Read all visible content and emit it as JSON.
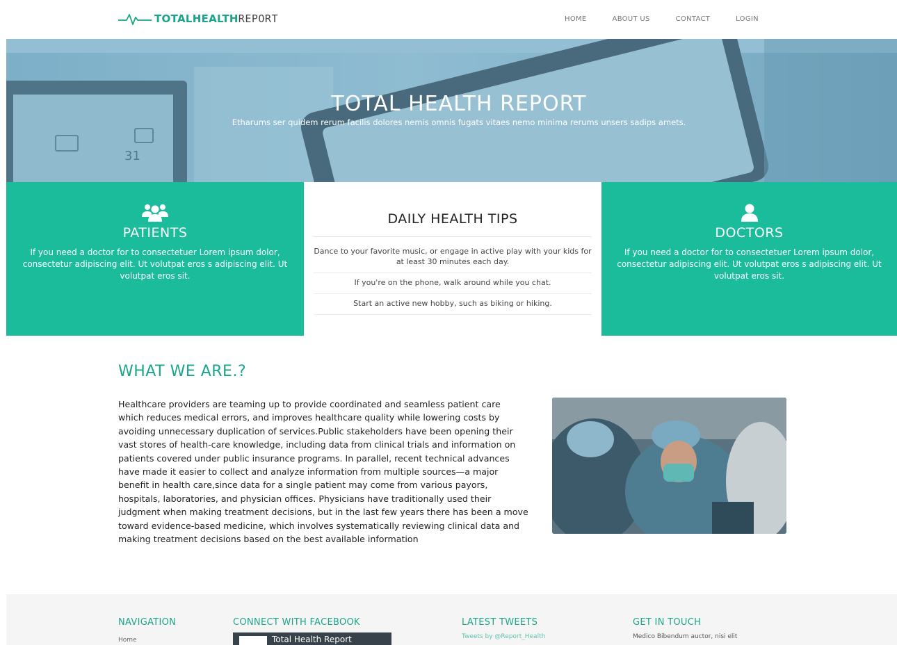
{
  "brand": {
    "name_strong": "TOTALHEALTH",
    "name_light": "REPORT",
    "accent_color": "#1abc9c",
    "logo_icon": "heartbeat-icon"
  },
  "nav": {
    "items": [
      {
        "label": "HOME"
      },
      {
        "label": "ABOUT US"
      },
      {
        "label": "CONTACT"
      },
      {
        "label": "LOGIN"
      }
    ]
  },
  "hero": {
    "title": "TOTAL HEALTH REPORT",
    "subtitle": "Etharums ser quidem rerum facilis dolores nemis omnis fugats vitaes nemo minima rerums unsers sadips amets.",
    "monitor_reading": "31"
  },
  "panels": {
    "patients": {
      "icon": "users-icon",
      "title": "PATIENTS",
      "text": "If you need a doctor for to consectetuer Lorem ipsum dolor, consectetur adipiscing elit. Ut volutpat eros s adipiscing elit. Ut volutpat eros sit."
    },
    "tips": {
      "title": "DAILY HEALTH TIPS",
      "items": [
        "Dance to your favorite music, or engage in active play with your kids for at least 30 minutes each day.",
        "If you're on the phone, walk around while you chat.",
        "Start an active new hobby, such as biking or hiking."
      ]
    },
    "doctors": {
      "icon": "user-icon",
      "title": "DOCTORS",
      "text": "If you need a doctor for to consectetuer Lorem ipsum dolor, consectetur adipiscing elit. Ut volutpat eros s adipiscing elit. Ut volutpat eros sit."
    }
  },
  "about": {
    "title": "WHAT WE ARE.?",
    "body": "Healthcare providers are teaming up to provide coordinated and seamless patient care which reduces medical errors, and improves healthcare quality while lowering costs by avoiding unnecessary duplication of services.Public stakeholders have been opening their vast stores of health-care knowledge, including data from clinical trials and information on patients covered under public insurance programs. In parallel, recent technical advances have made it easier to collect and analyze information from multiple sources—a major benefit in health care,since data for a single patient may come from various payors, hospitals, laboratories, and physician offices. Physicians have traditionally used their judgment when making treatment decisions, but in the last few years there has been a move toward evidence-based medicine, which involves systematically reviewing clinical data and making treatment decisions based on the best available information"
  },
  "footer": {
    "navigation": {
      "title": "NAVIGATION",
      "links": [
        "Home"
      ]
    },
    "facebook": {
      "title": "CONNECT WITH FACEBOOK",
      "page_name": "Total Health Report"
    },
    "tweets": {
      "title": "LATEST TWEETS",
      "byline": "Tweets by @Report_Health"
    },
    "contact": {
      "title": "GET IN TOUCH",
      "text": "Medico Bibendum auctor, nisi elit"
    }
  }
}
